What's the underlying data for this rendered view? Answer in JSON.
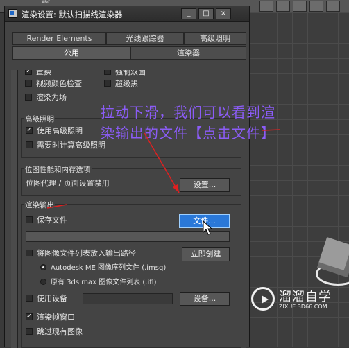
{
  "toolbar": {
    "abc_label": "ABC"
  },
  "dialog": {
    "title": "渲染设置: 默认扫描线渲染器",
    "window_buttons": [
      "_",
      "□",
      "×"
    ],
    "tabs_row1": [
      "Render Elements",
      "光线跟踪器",
      "高级照明"
    ],
    "tabs_row2": [
      "公用",
      "渲染器"
    ],
    "active_tab": "公用"
  },
  "options": {
    "partial_labels": [
      "置换",
      "强制双面"
    ],
    "video_color_check": "视频颜色检查",
    "render_to_fields": "渲染为场",
    "super_black": "超级黑"
  },
  "advanced_lighting": {
    "title": "高级照明",
    "use": "使用高级照明",
    "compute_when_required": "需要时计算高级照明"
  },
  "bitmap": {
    "title": "位图性能和内存选项",
    "status": "位图代理 / 页面设置禁用",
    "setup_button": "设置..."
  },
  "render_output": {
    "title": "渲染输出",
    "save_file": "保存文件",
    "files_button": "文件...",
    "put_list_label": "将图像文件列表放入输出路径",
    "create_now_button": "立即创建",
    "radio_autodesk": "Autodesk ME 图像序列文件 (.imsq)",
    "radio_legacy": "原有 3ds max 图像文件列表 (.ifl)",
    "use_device": "使用设备",
    "devices_button": "设备...",
    "rendered_frame_window": "渲染帧窗口",
    "skip_existing": "跳过现有图像"
  },
  "annotation": {
    "line1": "拉动下滑，我们可以看到渲",
    "line2": "染输出的文件【点击文件】",
    "color": "#8b5cf6"
  },
  "watermark": {
    "name": "溜溜自学",
    "url": "ZIXUE.3D66.COM"
  },
  "colors": {
    "dialog_bg": "#444444",
    "hot_button": "#2a78d8",
    "arrow": "#e02020"
  }
}
